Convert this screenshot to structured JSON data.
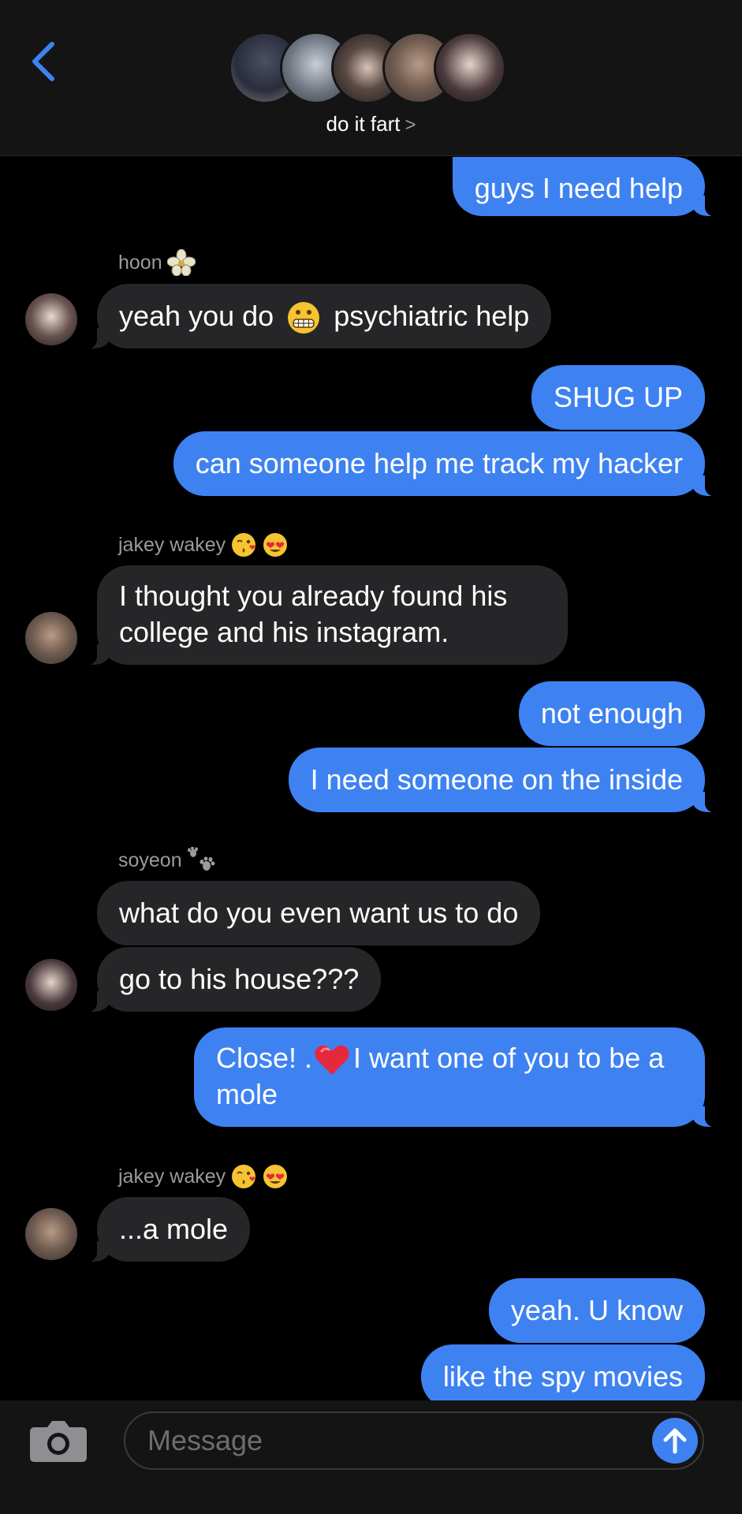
{
  "header": {
    "back_icon": "chevron-left-icon",
    "group_name": "do it fart",
    "group_chevron": ">",
    "accent": "#3e82f2"
  },
  "messages": {
    "m1": "guys I need help",
    "s1": "hoon",
    "m2a": "yeah you do",
    "m2b": "psychiatric help",
    "m3": "SHUG UP",
    "m4": "can someone help me track my hacker",
    "s2": "jakey wakey",
    "m5": "I thought you already found his college and his instagram.",
    "m6": "not enough",
    "m7": "I need someone on the inside",
    "s3": "soyeon",
    "m8": "what do you even want us to do",
    "m9": "go to his house???",
    "m10a": "Close! .",
    "m10b": "I want one of you to be a mole",
    "s4": "jakey wakey",
    "m11": "...a mole",
    "m12": "yeah. U know",
    "m13": "like the spy movies"
  },
  "composer": {
    "placeholder": "Message",
    "camera_icon": "camera-icon",
    "send_icon": "arrow-up-icon"
  }
}
